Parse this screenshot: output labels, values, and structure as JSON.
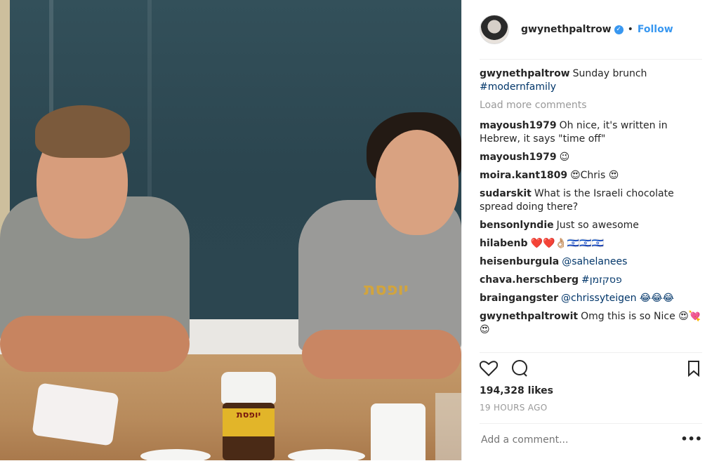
{
  "post": {
    "username": "gwynethpaltrow",
    "follow_label": "Follow",
    "caption_user": "gwynethpaltrow",
    "caption_text": "Sunday brunch",
    "caption_tag": "#modernfamily",
    "load_more": "Load more comments",
    "likes": "194,328 likes",
    "time": "19 HOURS AGO",
    "add_comment_placeholder": "Add a comment...",
    "more_icon": "•••"
  },
  "photo": {
    "jar_label": "יופסת",
    "shirt_print": "יופסת"
  },
  "comments": [
    {
      "user": "mayoush1979",
      "text": "Oh nice, it's written in Hebrew, it says \"time off\""
    },
    {
      "user": "mayoush1979",
      "text": "😉"
    },
    {
      "user": "moira.kant1809",
      "text": "😍Chris 😍"
    },
    {
      "user": "sudarskit",
      "text": "What is the Israeli chocolate spread doing there?"
    },
    {
      "user": "bensonlyndie",
      "text": "Just so awesome"
    },
    {
      "user": "hilabenb",
      "text": "❤️❤️👌🏼🇮🇱🇮🇱🇮🇱"
    },
    {
      "user": "heisenburgula",
      "text": "@sahelanees"
    },
    {
      "user": "chava.herschberg",
      "text": "#פסקזמן"
    },
    {
      "user": "braingangster",
      "text": "@chrissyteigen 😂😂😂"
    },
    {
      "user": "gwynethpaltrowit",
      "text": "Omg this is so Nice 😍💘😍"
    }
  ],
  "colors": {
    "link_blue": "#3897f0",
    "hashtag": "#003569",
    "text": "#262626",
    "muted": "#999999"
  }
}
